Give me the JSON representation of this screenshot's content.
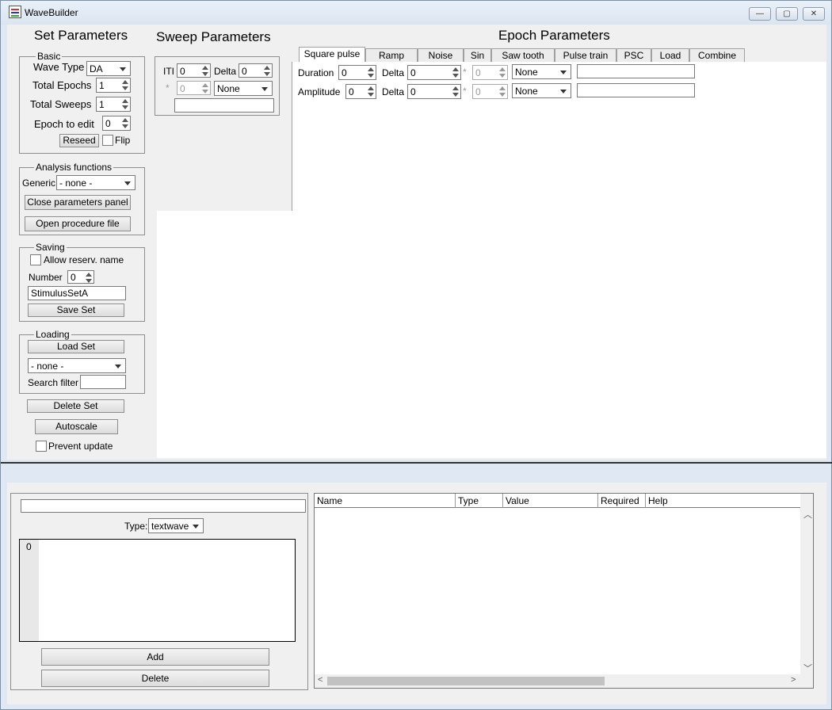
{
  "window": {
    "title": "WaveBuilder",
    "minimize": "—",
    "maximize": "▢",
    "close": "✕"
  },
  "headings": {
    "set_parameters": "Set Parameters",
    "sweep_parameters": "Sweep Parameters",
    "epoch_parameters": "Epoch Parameters"
  },
  "basic": {
    "title": "Basic",
    "wave_type_label": "Wave Type",
    "wave_type_value": "DA",
    "total_epochs_label": "Total Epochs",
    "total_epochs_value": "1",
    "total_sweeps_label": "Total Sweeps",
    "total_sweeps_value": "1",
    "epoch_to_edit_label": "Epoch to edit",
    "epoch_to_edit_value": "0",
    "reseed_label": "Reseed",
    "flip_label": "Flip"
  },
  "analysis": {
    "title": "Analysis functions",
    "generic_label": "Generic",
    "generic_value": "- none -",
    "close_panel_label": "Close parameters panel",
    "open_proc_label": "Open procedure file"
  },
  "saving": {
    "title": "Saving",
    "allow_reserv_label": "Allow reserv. name",
    "number_label": "Number",
    "number_value": "0",
    "name_value": "StimulusSetA",
    "save_set_label": "Save Set"
  },
  "loading": {
    "title": "Loading",
    "load_set_label": "Load Set",
    "set_select_value": "- none -",
    "search_filter_label": "Search filter",
    "search_filter_value": ""
  },
  "misc": {
    "delete_set_label": "Delete Set",
    "autoscale_label": "Autoscale",
    "prevent_update_label": "Prevent update"
  },
  "sweep": {
    "iti_label": "ITI",
    "iti_value": "0",
    "delta_label": "Delta",
    "delta_value": "0",
    "star": "*",
    "mult_value": "0",
    "op_value": "None",
    "formula_value": ""
  },
  "epoch_tabs": [
    "Square pulse",
    "Ramp",
    "Noise",
    "Sin",
    "Saw tooth",
    "Pulse train",
    "PSC",
    "Load",
    "Combine"
  ],
  "epoch": {
    "duration_label": "Duration",
    "duration_value": "0",
    "duration_delta_label": "Delta",
    "duration_delta_value": "0",
    "duration_mult_value": "0",
    "duration_op": "None",
    "duration_formula": "",
    "amplitude_label": "Amplitude",
    "amplitude_value": "0",
    "amplitude_delta_label": "Delta",
    "amplitude_delta_value": "0",
    "amplitude_mult_value": "0",
    "amplitude_op": "None",
    "amplitude_formula": "",
    "star": "*"
  },
  "lower": {
    "text_value": "",
    "type_label": "Type:",
    "type_value": "textwave",
    "list_index": "0",
    "add_label": "Add",
    "delete_label": "Delete"
  },
  "table": {
    "columns": [
      "Name",
      "Type",
      "Value",
      "Required",
      "Help"
    ]
  }
}
